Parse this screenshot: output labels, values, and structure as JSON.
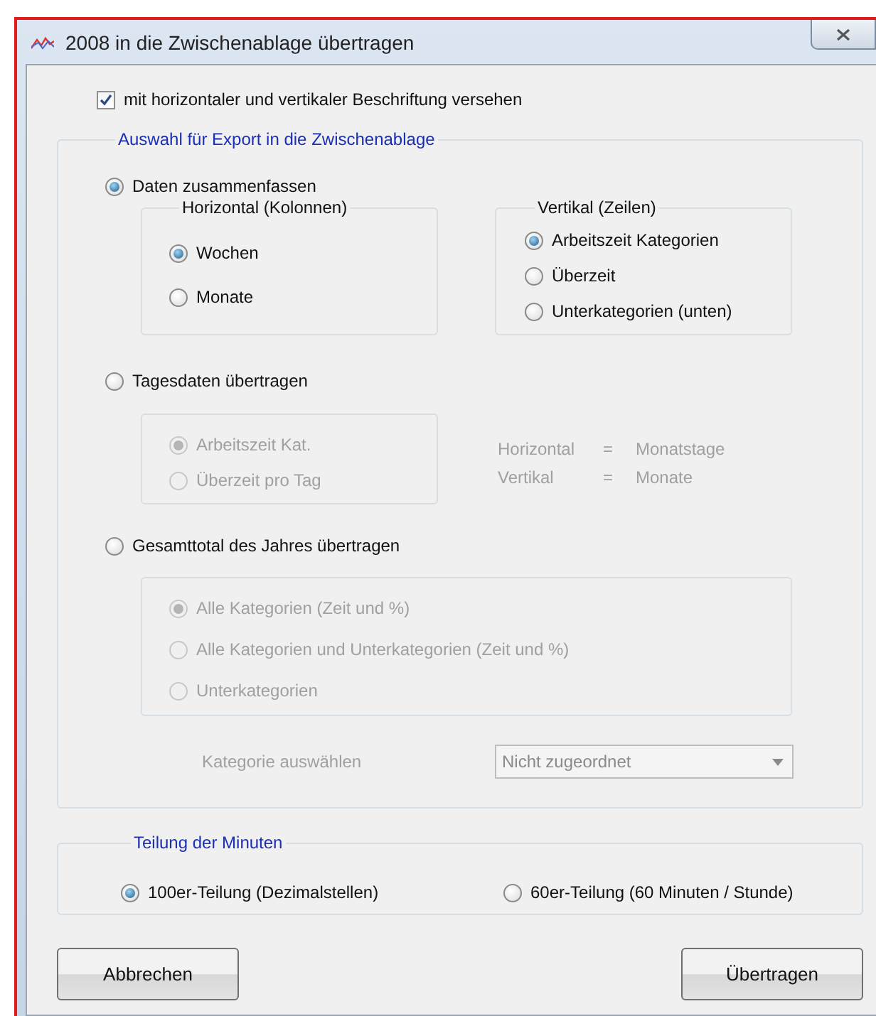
{
  "window": {
    "title": "2008 in die Zwischenablage übertragen"
  },
  "labels_option": {
    "label": "mit horizontaler und vertikaler Beschriftung versehen",
    "checked": true
  },
  "export": {
    "legend": "Auswahl für Export in die Zwischenablage",
    "modes": [
      {
        "kind": "grouped",
        "label": "Daten zusammenfassen",
        "selected": true,
        "groups": [
          {
            "legend": "Horizontal  (Kolonnen)",
            "options": [
              {
                "label": "Wochen",
                "selected": true,
                "disabled": false
              },
              {
                "label": "Monate",
                "selected": false,
                "disabled": false
              }
            ]
          },
          {
            "legend": "Vertikal  (Zeilen)",
            "options": [
              {
                "label": "Arbeitszeit Kategorien",
                "selected": true,
                "disabled": false
              },
              {
                "label": "Überzeit",
                "selected": false,
                "disabled": false
              },
              {
                "label": "Unterkategorien (unten)",
                "selected": false,
                "disabled": false
              }
            ]
          }
        ]
      },
      {
        "kind": "daily",
        "label": "Tagesdaten übertragen",
        "selected": false,
        "options": [
          {
            "label": "Arbeitszeit Kat.",
            "selected": true,
            "disabled": true
          },
          {
            "label": "Überzeit pro Tag",
            "selected": false,
            "disabled": true
          }
        ],
        "notes": [
          {
            "axis": "Horizontal",
            "sign": "=",
            "value": "Monatstage"
          },
          {
            "axis": "Vertikal",
            "sign": "=",
            "value": "Monate"
          }
        ]
      },
      {
        "kind": "total",
        "label": "Gesamttotal des Jahres übertragen",
        "selected": false,
        "options": [
          {
            "label": "Alle Kategorien (Zeit und %)",
            "selected": true,
            "disabled": true
          },
          {
            "label": "Alle Kategorien und Unterkategorien (Zeit und %)",
            "selected": false,
            "disabled": true
          },
          {
            "label": "Unterkategorien",
            "selected": false,
            "disabled": true
          }
        ],
        "category": {
          "label": "Kategorie auswählen",
          "value": "Nicht zugeordnet",
          "disabled": true
        }
      }
    ]
  },
  "minutes": {
    "legend": "Teilung der Minuten",
    "options": [
      {
        "label": "100er-Teilung (Dezimalstellen)",
        "selected": true
      },
      {
        "label": "60er-Teilung (60 Minuten / Stunde)",
        "selected": false
      }
    ]
  },
  "buttons": [
    {
      "label": "Abbrechen"
    },
    {
      "label": "Übertragen"
    }
  ]
}
